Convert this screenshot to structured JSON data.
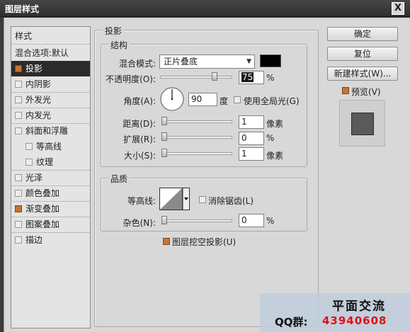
{
  "window": {
    "title": "图层样式",
    "close_label": "X"
  },
  "left_panel": {
    "header": "样式",
    "items": [
      {
        "label": "混合选项:默认",
        "checkbox": false,
        "checked": false,
        "selected": false,
        "indent": false
      },
      {
        "label": "投影",
        "checkbox": true,
        "checked": true,
        "selected": true,
        "indent": false
      },
      {
        "label": "内阴影",
        "checkbox": true,
        "checked": false,
        "selected": false,
        "indent": false
      },
      {
        "label": "外发光",
        "checkbox": true,
        "checked": false,
        "selected": false,
        "indent": false
      },
      {
        "label": "内发光",
        "checkbox": true,
        "checked": false,
        "selected": false,
        "indent": false
      },
      {
        "label": "斜面和浮雕",
        "checkbox": true,
        "checked": false,
        "selected": false,
        "indent": false
      },
      {
        "label": "等高线",
        "checkbox": true,
        "checked": false,
        "selected": false,
        "indent": true
      },
      {
        "label": "纹理",
        "checkbox": true,
        "checked": false,
        "selected": false,
        "indent": true
      },
      {
        "label": "光泽",
        "checkbox": true,
        "checked": false,
        "selected": false,
        "indent": false
      },
      {
        "label": "颜色叠加",
        "checkbox": true,
        "checked": false,
        "selected": false,
        "indent": false
      },
      {
        "label": "渐变叠加",
        "checkbox": true,
        "checked": true,
        "selected": false,
        "indent": false
      },
      {
        "label": "图案叠加",
        "checkbox": true,
        "checked": false,
        "selected": false,
        "indent": false
      },
      {
        "label": "描边",
        "checkbox": true,
        "checked": false,
        "selected": false,
        "indent": false
      }
    ]
  },
  "drop_shadow": {
    "group_title": "投影",
    "structure": {
      "title": "结构",
      "blend_mode_label": "混合模式:",
      "blend_mode_value": "正片叠底",
      "shadow_color": "#000000",
      "opacity_label": "不透明度(O):",
      "opacity_value": "75",
      "opacity_fraction": 0.75,
      "percent_unit": "%",
      "angle_label": "角度(A):",
      "angle_value": "90",
      "angle_unit": "度",
      "global_light_label": "使用全局光(G)",
      "global_light_checked": false,
      "distance_label": "距离(D):",
      "distance_value": "1",
      "distance_unit": "像素",
      "spread_label": "扩展(R):",
      "spread_value": "0",
      "spread_unit": "%",
      "size_label": "大小(S):",
      "size_value": "1",
      "size_unit": "像素"
    },
    "quality": {
      "title": "品质",
      "contour_label": "等高线:",
      "antialias_label": "消除锯齿(L)",
      "antialias_checked": false,
      "noise_label": "杂色(N):",
      "noise_value": "0",
      "noise_unit": "%",
      "knockout_label": "图层挖空投影(U)",
      "knockout_checked": true
    }
  },
  "buttons": {
    "ok": "确定",
    "reset": "复位",
    "new_style": "新建样式(W)...",
    "preview_label": "预览(V)",
    "preview_checked": true
  },
  "watermark": {
    "line1": "平面交流",
    "qq_label": "QQ群:",
    "qq_number": "43940608"
  },
  "colors": {
    "checked": "#c8742f",
    "selected_row": "#2b2b2b"
  }
}
